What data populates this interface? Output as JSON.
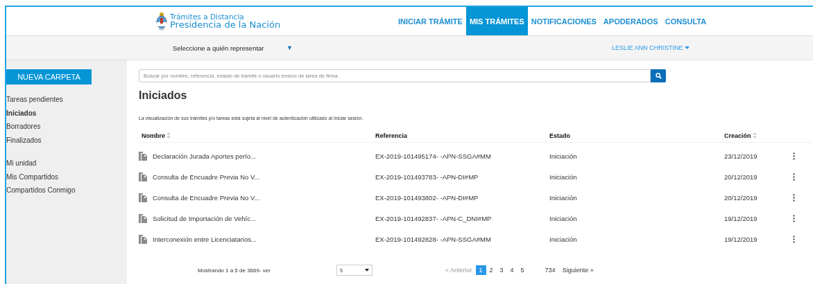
{
  "brand": {
    "line1": "Trámites a Distancia",
    "line2": "Presidencia de la Nación"
  },
  "nav": [
    {
      "label": "INICIAR TRÁMITE",
      "selected": false
    },
    {
      "label": "MIS TRÁMITES",
      "selected": true
    },
    {
      "label": "NOTIFICACIONES",
      "selected": false
    },
    {
      "label": "APODERADOS",
      "selected": false
    },
    {
      "label": "CONSULTA",
      "selected": false
    }
  ],
  "represent": {
    "label": "Seleccione a quién representar",
    "caret": "▼"
  },
  "user": "LESLIE ANN CHRISTINE",
  "sidebar": {
    "button": "NUEVA CARPETA",
    "groups": [
      [
        {
          "label": "Tareas pendientes",
          "selected": false
        },
        {
          "label": "Iniciados",
          "selected": true
        },
        {
          "label": "Borradores",
          "selected": false
        },
        {
          "label": "Finalizados",
          "selected": false
        }
      ],
      [
        {
          "label": "Mi unidad",
          "selected": false
        },
        {
          "label": "Mis Compartidos",
          "selected": false
        },
        {
          "label": "Compartidos Conmigo",
          "selected": false
        }
      ]
    ]
  },
  "search": {
    "placeholder": "Buscar por nombre, referencia, estado de trámite o usuario emisor de tarea de firma."
  },
  "title": "Iniciados",
  "notice": "La visualización de sus trámites y/o tareas está sujeta al nivel de autenticación utilizado al iniciar sesión.",
  "table": {
    "columns": [
      {
        "label": "Nombre",
        "sortable": true
      },
      {
        "label": "Referencia",
        "sortable": false
      },
      {
        "label": "Estado",
        "sortable": false
      },
      {
        "label": "Creación",
        "sortable": true
      }
    ],
    "rows": [
      [
        "Declaración Jurada Aportes perío...",
        "EX-2019-101495174- -APN-SSGA#MM",
        "Iniciación",
        "23/12/2019"
      ],
      [
        "Consulta de Encuadre Previa No V...",
        "EX-2019-101493783- -APN-DI#MP",
        "Iniciación",
        "20/12/2019"
      ],
      [
        "Consulta de Encuadre Previa No V...",
        "EX-2019-101493802- -APN-DI#MP",
        "Iniciación",
        "20/12/2019"
      ],
      [
        "Solicitud de Importación de Vehíc...",
        "EX-2019-101492837- -APN-C_DNI#MP",
        "Iniciación",
        "19/12/2019"
      ],
      [
        "Interconexión entre Licenciatarios...",
        "EX-2019-101492828- -APN-SSGA#MM",
        "Iniciación",
        "19/12/2019"
      ]
    ]
  },
  "footer": {
    "showing": "Mostrando 1 a 5 de 3669- ver",
    "page_size": "5",
    "prev": "« Anterior",
    "pages": [
      {
        "label": "1",
        "selected": true
      },
      {
        "label": "2",
        "selected": false
      },
      {
        "label": "3",
        "selected": false
      },
      {
        "label": "4",
        "selected": false
      },
      {
        "label": "5",
        "selected": false
      },
      {
        "label": "734",
        "selected": false
      }
    ],
    "next": "Siguiente »"
  }
}
